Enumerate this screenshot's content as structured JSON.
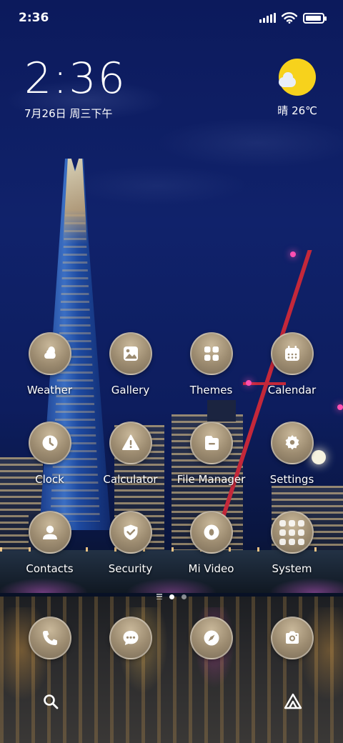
{
  "status_bar": {
    "time": "2:36",
    "icons": [
      "signal-icon",
      "wifi-icon",
      "battery-icon"
    ],
    "battery_level": 0.95
  },
  "clock_widget": {
    "time": "2:36",
    "date": "7月26日 周三下午"
  },
  "weather_widget": {
    "icon": "sunny-cloud-icon",
    "text": "晴 26℃"
  },
  "apps": [
    {
      "label": "Weather",
      "icon": "weather-icon"
    },
    {
      "label": "Gallery",
      "icon": "gallery-icon"
    },
    {
      "label": "Themes",
      "icon": "themes-icon"
    },
    {
      "label": "Calendar",
      "icon": "calendar-icon"
    },
    {
      "label": "Clock",
      "icon": "clock-icon"
    },
    {
      "label": "Calculator",
      "icon": "calculator-icon"
    },
    {
      "label": "File Manager",
      "icon": "file-manager-icon"
    },
    {
      "label": "Settings",
      "icon": "settings-icon"
    },
    {
      "label": "Contacts",
      "icon": "contacts-icon"
    },
    {
      "label": "Security",
      "icon": "security-icon"
    },
    {
      "label": "Mi Video",
      "icon": "video-icon"
    },
    {
      "label": "System",
      "icon": "folder-icon"
    }
  ],
  "dock": [
    {
      "icon": "phone-icon"
    },
    {
      "icon": "messages-icon"
    },
    {
      "icon": "browser-compass-icon"
    },
    {
      "icon": "camera-icon"
    }
  ],
  "page_indicator": {
    "pages": 2,
    "active": 0
  },
  "bottom_bar": {
    "left_icon": "search-icon",
    "right_icon": "app-vault-icon"
  },
  "colors": {
    "icon_fill": "#9c8b70",
    "sun": "#f7d21c",
    "sky": "#0c1a5c"
  }
}
